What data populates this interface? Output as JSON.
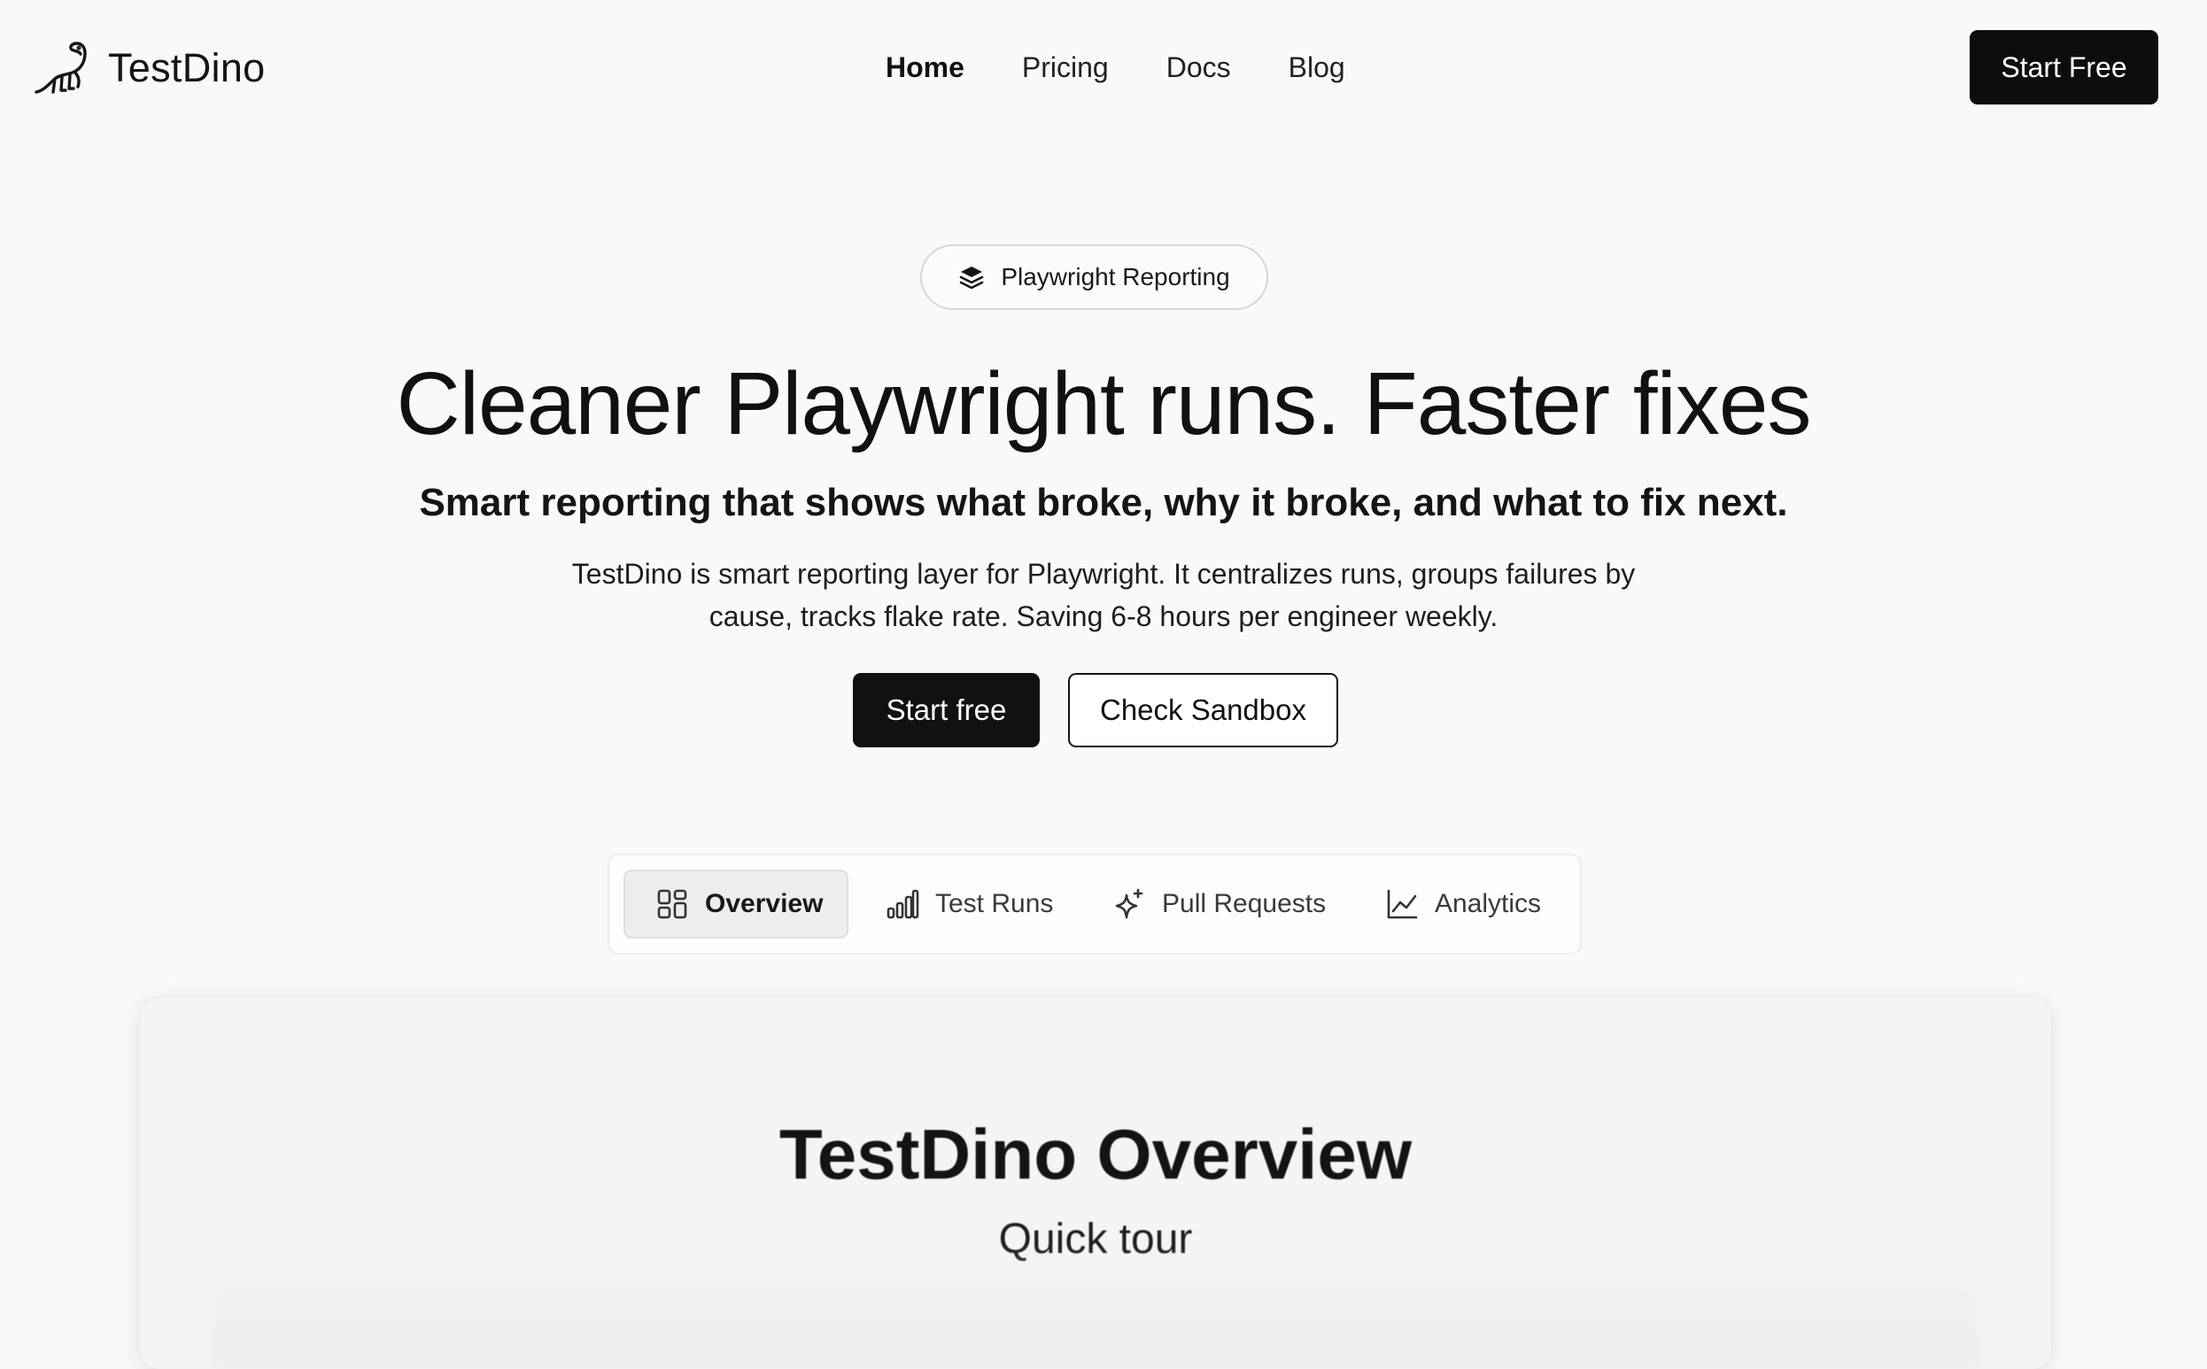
{
  "nav": {
    "brand": "TestDino",
    "links": [
      {
        "label": "Home",
        "active": true
      },
      {
        "label": "Pricing",
        "active": false
      },
      {
        "label": "Docs",
        "active": false
      },
      {
        "label": "Blog",
        "active": false
      }
    ],
    "cta_label": "Start Free"
  },
  "hero": {
    "badge_label": "Playwright Reporting",
    "badge_icon": "layers-icon",
    "headline": "Cleaner Playwright runs. Faster fixes",
    "subheadline": "Smart reporting that shows what broke, why it broke, and what to fix next.",
    "description_lines": [
      "TestDino is smart reporting layer for Playwright. It centralizes runs, groups failures by",
      "cause, tracks flake rate. Saving 6-8 hours per engineer weekly."
    ],
    "primary_cta": "Start free",
    "secondary_cta": "Check Sandbox"
  },
  "tabs": [
    {
      "label": "Overview",
      "icon": "grid-icon",
      "active": true
    },
    {
      "label": "Test Runs",
      "icon": "bar-chart-icon",
      "active": false
    },
    {
      "label": "Pull Requests",
      "icon": "sparkle-icon",
      "active": false
    },
    {
      "label": "Analytics",
      "icon": "line-chart-icon",
      "active": false
    }
  ],
  "preview": {
    "title": "TestDino Overview",
    "subtitle": "Quick tour"
  },
  "colors": {
    "background": "#f9f9f9",
    "primary_button": "#111111",
    "text": "#111111",
    "tab_active_bg": "#ededed"
  }
}
